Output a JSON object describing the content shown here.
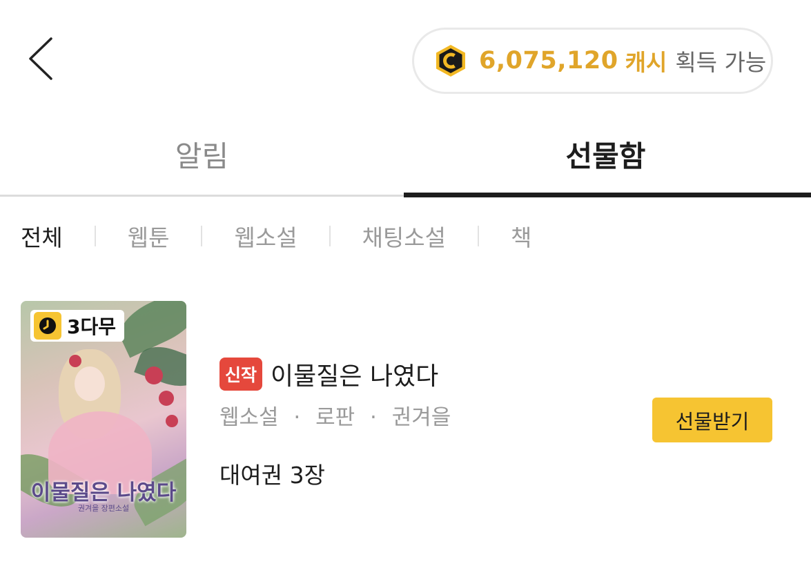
{
  "header": {
    "back_icon": "chevron-left-icon",
    "cash": {
      "icon": "cash-coin-icon",
      "amount": "6,075,120",
      "unit": "캐시",
      "suffix": "획득 가능",
      "accent_color": "#e0a52a"
    }
  },
  "tabs": [
    {
      "label": "알림",
      "active": false
    },
    {
      "label": "선물함",
      "active": true
    }
  ],
  "filters": [
    {
      "label": "전체",
      "active": true
    },
    {
      "label": "웹툰",
      "active": false
    },
    {
      "label": "웹소설",
      "active": false
    },
    {
      "label": "채팅소설",
      "active": false
    },
    {
      "label": "책",
      "active": false
    }
  ],
  "gift_item": {
    "cover": {
      "wait_badge": "3다무",
      "wait_icon": "clock-icon",
      "title_art": "이물질은 나였다",
      "subtitle_art": "권겨을 장편소설"
    },
    "new_badge": "신작",
    "title": "이물질은 나였다",
    "meta": [
      "웹소설",
      "로판",
      "권겨을"
    ],
    "meta_separator": "·",
    "ticket": "대여권 3장",
    "button_label": "선물받기",
    "button_color": "#f6c432"
  }
}
